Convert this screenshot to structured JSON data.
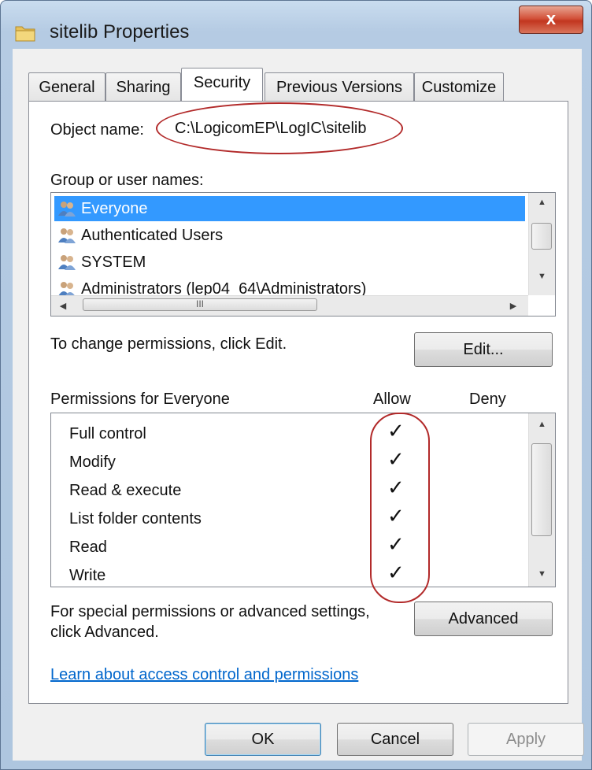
{
  "window": {
    "title": "sitelib Properties",
    "close_label": "x"
  },
  "tabs": [
    {
      "label": "General",
      "active": false
    },
    {
      "label": "Sharing",
      "active": false
    },
    {
      "label": "Security",
      "active": true
    },
    {
      "label": "Previous Versions",
      "active": false
    },
    {
      "label": "Customize",
      "active": false
    }
  ],
  "object": {
    "label": "Object name:",
    "value": "C:\\LogicomEP\\LogIC\\sitelib"
  },
  "groups": {
    "label": "Group or user names:",
    "items": [
      {
        "name": "Everyone",
        "selected": true
      },
      {
        "name": "Authenticated Users",
        "selected": false
      },
      {
        "name": "SYSTEM",
        "selected": false
      },
      {
        "name": "Administrators (lep04_64\\Administrators)",
        "selected": false
      }
    ],
    "hscroll_thumb": "III"
  },
  "edit": {
    "hint": "To change permissions, click Edit.",
    "button": "Edit..."
  },
  "permissions": {
    "label": "Permissions for Everyone",
    "allow_header": "Allow",
    "deny_header": "Deny",
    "rows": [
      {
        "name": "Full control",
        "allow": "✓",
        "deny": ""
      },
      {
        "name": "Modify",
        "allow": "✓",
        "deny": ""
      },
      {
        "name": "Read & execute",
        "allow": "✓",
        "deny": ""
      },
      {
        "name": "List folder contents",
        "allow": "✓",
        "deny": ""
      },
      {
        "name": "Read",
        "allow": "✓",
        "deny": ""
      },
      {
        "name": "Write",
        "allow": "✓",
        "deny": ""
      }
    ]
  },
  "advanced": {
    "hint_line1": "For special permissions or advanced settings,",
    "hint_line2": "click Advanced.",
    "button": "Advanced"
  },
  "link": {
    "text": "Learn about access control and permissions"
  },
  "footer": {
    "ok": "OK",
    "cancel": "Cancel",
    "apply": "Apply"
  },
  "colors": {
    "selection": "#3399ff",
    "annotation": "#b22a2a",
    "link": "#0066cc"
  }
}
